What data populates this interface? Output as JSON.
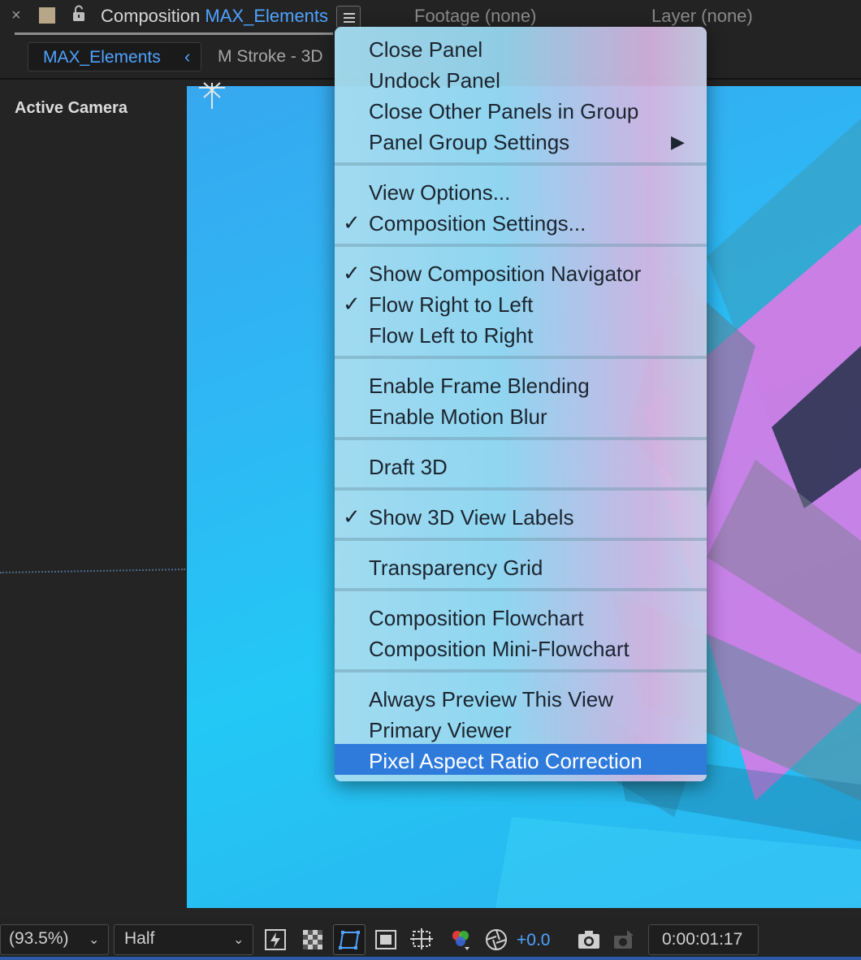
{
  "header": {
    "close_glyph": "×",
    "comp_prefix": "Composition",
    "comp_name": "MAX_Elements",
    "footage": "Footage (none)",
    "layer": "Layer (none)"
  },
  "subtabs": {
    "active": "MAX_Elements",
    "active_chevron": "‹",
    "second": "M Stroke - 3D"
  },
  "viewer": {
    "active_camera": "Active Camera"
  },
  "menu": {
    "groups": [
      [
        {
          "label": "Close Panel",
          "checked": false
        },
        {
          "label": "Undock Panel",
          "checked": false
        },
        {
          "label": "Close Other Panels in Group",
          "checked": false
        },
        {
          "label": "Panel Group Settings",
          "checked": false,
          "submenu": true
        }
      ],
      [
        {
          "label": "View Options...",
          "checked": false
        },
        {
          "label": "Composition Settings...",
          "checked": true
        }
      ],
      [
        {
          "label": "Show Composition Navigator",
          "checked": true
        },
        {
          "label": "Flow Right to Left",
          "checked": true
        },
        {
          "label": "Flow Left to Right",
          "checked": false
        }
      ],
      [
        {
          "label": "Enable Frame Blending",
          "checked": false
        },
        {
          "label": "Enable Motion Blur",
          "checked": false
        }
      ],
      [
        {
          "label": "Draft 3D",
          "checked": false
        }
      ],
      [
        {
          "label": "Show 3D View Labels",
          "checked": true
        }
      ],
      [
        {
          "label": "Transparency Grid",
          "checked": false
        }
      ],
      [
        {
          "label": "Composition Flowchart",
          "checked": false
        },
        {
          "label": "Composition Mini-Flowchart",
          "checked": false
        }
      ],
      [
        {
          "label": "Always Preview This View",
          "checked": false
        },
        {
          "label": "Primary Viewer",
          "checked": false
        },
        {
          "label": "Pixel Aspect Ratio Correction",
          "checked": false,
          "highlighted": true
        }
      ]
    ],
    "check_glyph": "✓",
    "submenu_glyph": "▶"
  },
  "toolbar": {
    "zoom": "(93.5%)",
    "resolution": "Half",
    "exposure": "+0.0",
    "timecode": "0:00:01:17",
    "icons": [
      "fast-preview-icon",
      "transparency-grid-icon",
      "mask-visibility-icon",
      "region-of-interest-icon",
      "guides-icon",
      "channel-icon",
      "exposure-reset-icon",
      "snapshot-camera-icon",
      "show-snapshot-icon"
    ]
  },
  "colors": {
    "accent_blue": "#4ea3ff",
    "menu_highlight": "#2e7bdc",
    "panel_bg": "#232323"
  }
}
